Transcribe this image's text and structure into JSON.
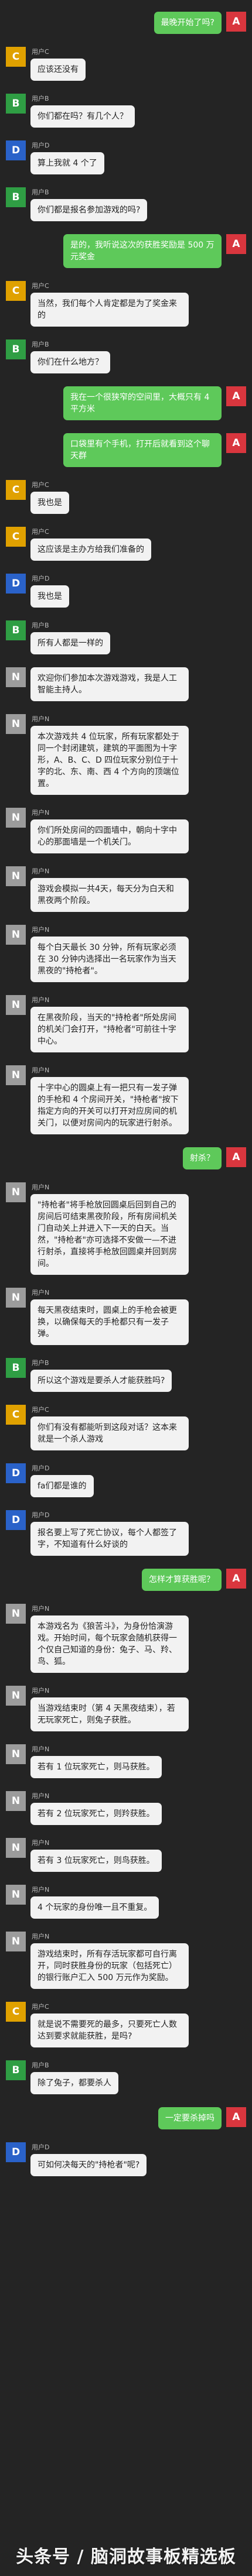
{
  "messages": [
    {
      "side": "right",
      "avatar": "A",
      "name": "",
      "text": "最晚开始了吗?"
    },
    {
      "side": "left",
      "avatar": "C",
      "name": "用户C",
      "text": "应该还没有"
    },
    {
      "side": "left",
      "avatar": "B",
      "name": "用户B",
      "text": "你们都在吗？有几个人？"
    },
    {
      "side": "left",
      "avatar": "D",
      "name": "用户D",
      "text": "算上我就 4 个了"
    },
    {
      "side": "left",
      "avatar": "B",
      "name": "用户B",
      "text": "你们都是报名参加游戏的吗?"
    },
    {
      "side": "right",
      "avatar": "A",
      "name": "",
      "text": "是的，我听说这次的获胜奖励是 500 万元奖金"
    },
    {
      "side": "left",
      "avatar": "C",
      "name": "用户C",
      "text": "当然，我们每个人肯定都是为了奖金来的"
    },
    {
      "side": "left",
      "avatar": "B",
      "name": "用户B",
      "text": "你们在什么地方？"
    },
    {
      "side": "right",
      "avatar": "A",
      "name": "",
      "text": "我在一个很狭窄的空间里，大概只有 4 平方米"
    },
    {
      "side": "right",
      "avatar": "A",
      "name": "",
      "text": "口袋里有个手机，打开后就看到这个聊天群"
    },
    {
      "side": "left",
      "avatar": "C",
      "name": "用户C",
      "text": "我也是"
    },
    {
      "side": "left",
      "avatar": "C",
      "name": "用户C",
      "text": "这应该是主办方给我们准备的"
    },
    {
      "side": "left",
      "avatar": "D",
      "name": "用户D",
      "text": "我也是"
    },
    {
      "side": "left",
      "avatar": "B",
      "name": "用户B",
      "text": "所有人都是一样的"
    },
    {
      "side": "left",
      "avatar": "N",
      "name": "",
      "text": "欢迎你们参加本次游戏游戏，我是人工智能主持人。"
    },
    {
      "side": "left",
      "avatar": "N",
      "name": "用户N",
      "text": "本次游戏共 4 位玩家，所有玩家都处于同一个封闭建筑，建筑的平面图为十字形，A、B、C、D 四位玩家分别位于十字的北、东、南、西 4 个方向的顶端位置。"
    },
    {
      "side": "left",
      "avatar": "N",
      "name": "用户N",
      "text": "你们所处房间的四面墙中，朝向十字中心的那面墙是一个机关门。"
    },
    {
      "side": "left",
      "avatar": "N",
      "name": "用户N",
      "text": "游戏会模拟一共4天，每天分为白天和黑夜两个阶段。"
    },
    {
      "side": "left",
      "avatar": "N",
      "name": "用户N",
      "text": "每个白天最长 30 分钟，所有玩家必须在 30 分钟内选择出一名玩家作为当天黑夜的\"持枪者\"。"
    },
    {
      "side": "left",
      "avatar": "N",
      "name": "用户N",
      "text": "在黑夜阶段，当天的\"持枪者\"所处房间的机关门会打开，\"持枪者\"可前往十字中心。"
    },
    {
      "side": "left",
      "avatar": "N",
      "name": "用户N",
      "text": "十字中心的圆桌上有一把只有一发子弹的手枪和 4 个房间开关，\"持枪者\"按下指定方向的开关可以打开对应房间的机关门，以便对房间内的玩家进行射杀。"
    },
    {
      "side": "right",
      "avatar": "A",
      "name": "",
      "text": "射杀？"
    },
    {
      "side": "left",
      "avatar": "N",
      "name": "用户N",
      "text": "\"持枪者\"将手枪放回圆桌后回到自己的房间后可结束黑夜阶段，所有房间机关门自动关上并进入下一天的白天。当然，\"持枪者\"亦可选择不安做一—不进行射杀，直接将手枪放回圆桌并回到房间。"
    },
    {
      "side": "left",
      "avatar": "N",
      "name": "用户N",
      "text": "每天黑夜结束时，圆桌上的手枪会被更换，以确保每天的手枪都只有一发子弹。"
    },
    {
      "side": "left",
      "avatar": "B",
      "name": "用户B",
      "text": "所以这个游戏是要杀人才能获胜吗?"
    },
    {
      "side": "left",
      "avatar": "C",
      "name": "用户C",
      "text": "你们有没有都能听到这段对话？这本来就是一个杀人游戏"
    },
    {
      "side": "left",
      "avatar": "D",
      "name": "用户D",
      "text": "fa们都是谁的"
    },
    {
      "side": "left",
      "avatar": "D",
      "name": "用户D",
      "text": "报名要上写了死亡协议，每个人都签了字，不知道有什么好谈的"
    },
    {
      "side": "right",
      "avatar": "A",
      "name": "",
      "text": "怎样才算获胜呢？"
    },
    {
      "side": "left",
      "avatar": "N",
      "name": "用户N",
      "text": "本游戏名为《狼苦斗》，为身份恰演游戏。开始时间，每个玩家会随机获得一个仅自己知道的身份：兔子、马、羚、鸟、狐。"
    },
    {
      "side": "left",
      "avatar": "N",
      "name": "用户N",
      "text": "当游戏结束时（第 4 天黑夜结束），若无玩家死亡，则兔子获胜。"
    },
    {
      "side": "left",
      "avatar": "N",
      "name": "用户N",
      "text": "若有 1 位玩家死亡，则马获胜。"
    },
    {
      "side": "left",
      "avatar": "N",
      "name": "用户N",
      "text": "若有 2 位玩家死亡，则羚获胜。"
    },
    {
      "side": "left",
      "avatar": "N",
      "name": "用户N",
      "text": "若有 3 位玩家死亡，则鸟获胜。"
    },
    {
      "side": "left",
      "avatar": "N",
      "name": "用户N",
      "text": "4 个玩家的身份唯一且不重复。"
    },
    {
      "side": "left",
      "avatar": "N",
      "name": "用户N",
      "text": "游戏结束时，所有存活玩家都可自行离开，同时获胜身份的玩家（包括死亡）的银行账户汇入 500 万元作为奖励。"
    },
    {
      "side": "left",
      "avatar": "C",
      "name": "用户C",
      "text": "就是说不需要死的最多，只要死亡人数达到要求就能获胜，是吗?"
    },
    {
      "side": "left",
      "avatar": "B",
      "name": "用户B",
      "text": "除了兔子，都要杀人"
    },
    {
      "side": "right",
      "avatar": "A",
      "name": "",
      "text": "一定要杀掉吗"
    },
    {
      "side": "left",
      "avatar": "D",
      "name": "用户D",
      "text": "可如何决每天的\"持枪者\"呢?"
    }
  ],
  "watermark": "头条号 / 脑洞故事板精选板"
}
